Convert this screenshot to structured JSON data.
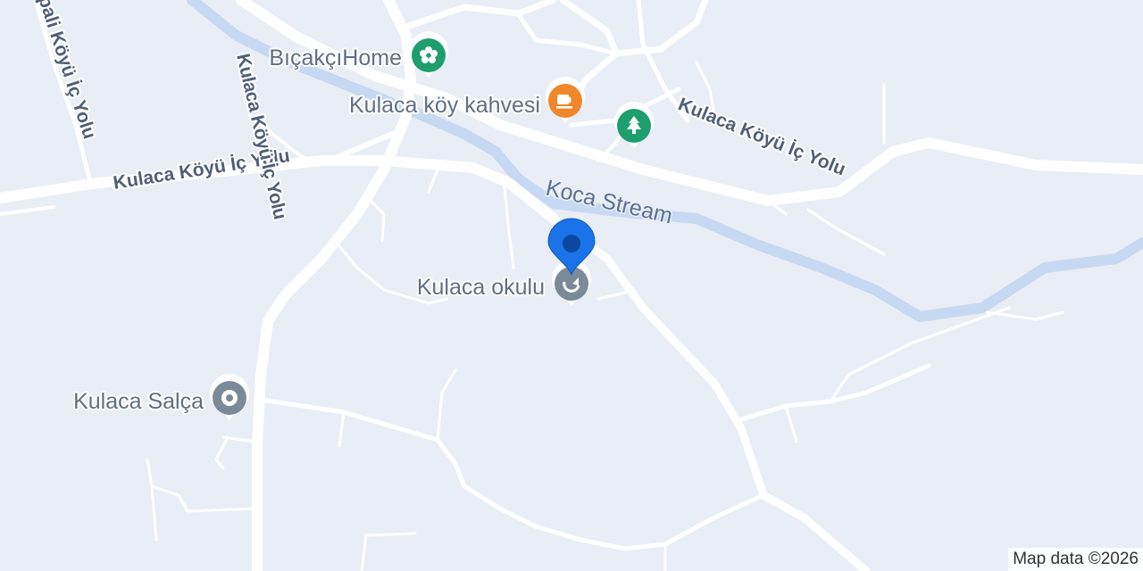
{
  "map": {
    "background": "#e9edf5",
    "road_color": "#ffffff",
    "water_color": "#c6d8f2",
    "pin_color": "#1a73e8"
  },
  "labels": {
    "poi_bicakci": "BıçakçıHome",
    "poi_kahve": "Kulaca köy kahvesi",
    "poi_okul": "Kulaca okulu",
    "poi_salca": "Kulaca Salça",
    "water_stream": "Koca Stream",
    "road_left": "Kulaca Köyü İç Yolu",
    "road_right": "Kulaca Köyü İç Yolu",
    "road_vertical": "Kulaca Köyü İç Yolu",
    "road_far_left": "pali Köyü İç Yolu"
  },
  "icons": {
    "bicakci": "flower-icon",
    "kahve": "coffee-cup-icon",
    "park": "tree-icon",
    "okul": "school-icon",
    "salca": "place-marker-icon",
    "pin": "location-pin-icon"
  },
  "colors": {
    "green_poi": "#1e9e6e",
    "orange_poi": "#f0872a",
    "gray_poi": "#7b8a98"
  },
  "attribution": "Map data ©2026"
}
